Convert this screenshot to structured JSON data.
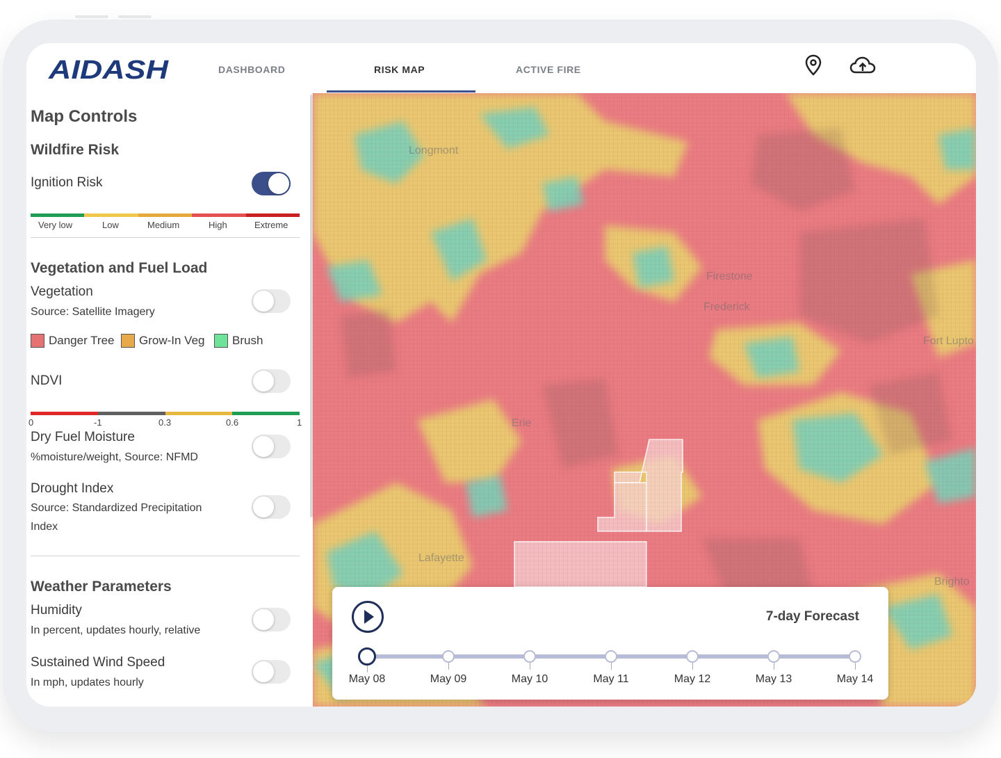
{
  "app": {
    "name": "AIDASH",
    "accent": "#3b4f8a"
  },
  "nav": {
    "tabs": [
      {
        "label": "DASHBOARD",
        "active": false
      },
      {
        "label": "RISK MAP",
        "active": true
      },
      {
        "label": "ACTIVE FIRE",
        "active": false
      }
    ],
    "icons": [
      "location-pin-icon",
      "cloud-upload-icon"
    ]
  },
  "sidebar": {
    "title": "Map Controls",
    "wildfire": {
      "heading": "Wildfire Risk",
      "ignition_label": "Ignition Risk",
      "ignition_on": true,
      "scale": [
        {
          "label": "Very low",
          "color": "#1f9d55"
        },
        {
          "label": "Low",
          "color": "#f0c94c"
        },
        {
          "label": "Medium",
          "color": "#e5a93c"
        },
        {
          "label": "High",
          "color": "#e45050"
        },
        {
          "label": "Extreme",
          "color": "#c82020"
        }
      ]
    },
    "vegetation": {
      "heading": "Vegetation and Fuel Load",
      "veg_label": "Vegetation",
      "veg_source": "Source: Satellite Imagery",
      "legend": [
        {
          "label": "Danger Tree",
          "color": "#e57373"
        },
        {
          "label": "Grow-In Veg",
          "color": "#e8a94a"
        },
        {
          "label": "Brush",
          "color": "#6fe39a"
        }
      ],
      "ndvi_label": "NDVI",
      "ndvi_scale": {
        "ticks": [
          "0",
          "-1",
          "0.3",
          "0.6",
          "1"
        ],
        "colors": [
          "#e02828",
          "#606060",
          "#e8b840",
          "#1f9d55"
        ]
      },
      "dry_label": "Dry Fuel Moisture",
      "dry_source": "%moisture/weight, Source: NFMD",
      "drought_label": "Drought Index",
      "drought_source_1": "Source: Standardized Precipitation",
      "drought_source_2": "Index"
    },
    "weather": {
      "heading": "Weather Parameters",
      "humidity_label": "Humidity",
      "humidity_desc": "In percent, updates hourly, relative",
      "wind_label": "Sustained Wind Speed",
      "wind_desc": "In mph, updates hourly"
    }
  },
  "map": {
    "labels": [
      "Longmont",
      "Firestone",
      "Frederick",
      "Fort Lupto",
      "Erie",
      "Lafayette",
      "Brighto"
    ]
  },
  "forecast": {
    "title": "7-day Forecast",
    "days": [
      "May 08",
      "May 09",
      "May 10",
      "May 11",
      "May 12",
      "May 13",
      "May 14"
    ],
    "current_index": 0
  }
}
